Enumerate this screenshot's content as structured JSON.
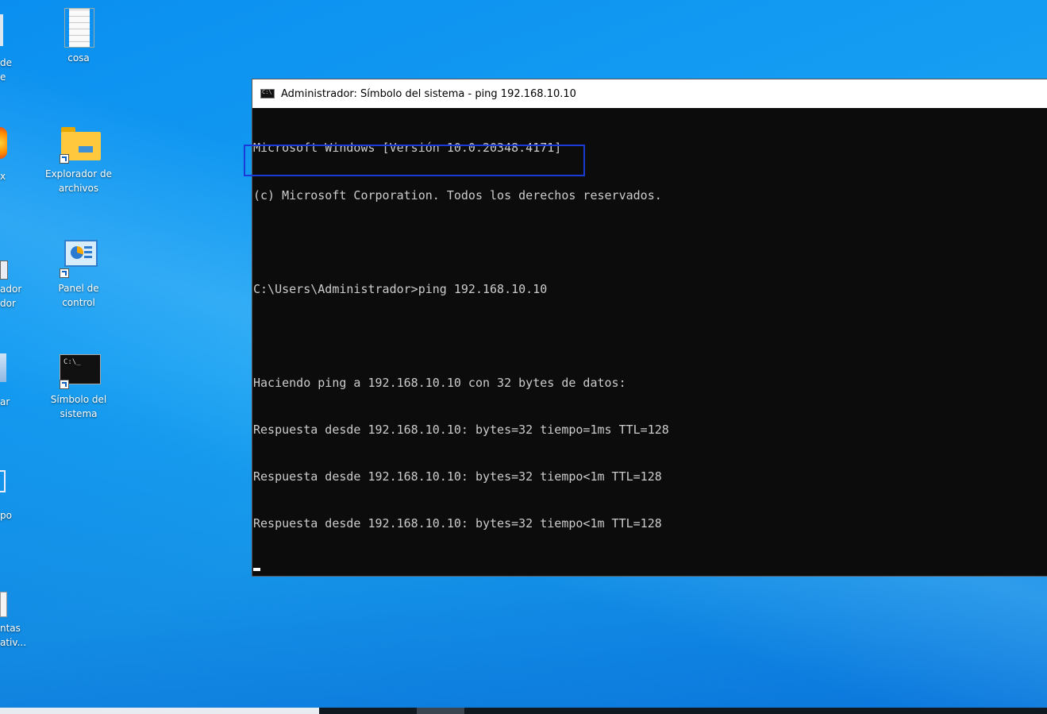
{
  "desktop": {
    "icons": [
      {
        "label": "cosa"
      },
      {
        "label": "Explorador de archivos"
      },
      {
        "label": "Panel de control"
      },
      {
        "label": "Símbolo del sistema"
      }
    ],
    "partial_labels": [
      {
        "text": "de"
      },
      {
        "text": "e"
      },
      {
        "text": "x"
      },
      {
        "text": "ador"
      },
      {
        "text": "dor"
      },
      {
        "text": "ar"
      },
      {
        "text": "po"
      },
      {
        "text": "ntas"
      },
      {
        "text": "ativ..."
      }
    ]
  },
  "window": {
    "title": "Administrador: Símbolo del sistema - ping  192.168.10.10",
    "lines": [
      "Microsoft Windows [Versión 10.0.20348.4171]",
      "(c) Microsoft Corporation. Todos los derechos reservados.",
      "",
      "C:\\Users\\Administrador>ping 192.168.10.10",
      "",
      "Haciendo ping a 192.168.10.10 con 32 bytes de datos:",
      "Respuesta desde 192.168.10.10: bytes=32 tiempo=1ms TTL=128",
      "Respuesta desde 192.168.10.10: bytes=32 tiempo<1m TTL=128",
      "Respuesta desde 192.168.10.10: bytes=32 tiempo<1m TTL=128"
    ]
  },
  "colors": {
    "desktop_blue": "#149cf2",
    "console_bg": "#0c0c0c",
    "console_text": "#cccccc",
    "highlight_border": "#1a3bd6"
  }
}
